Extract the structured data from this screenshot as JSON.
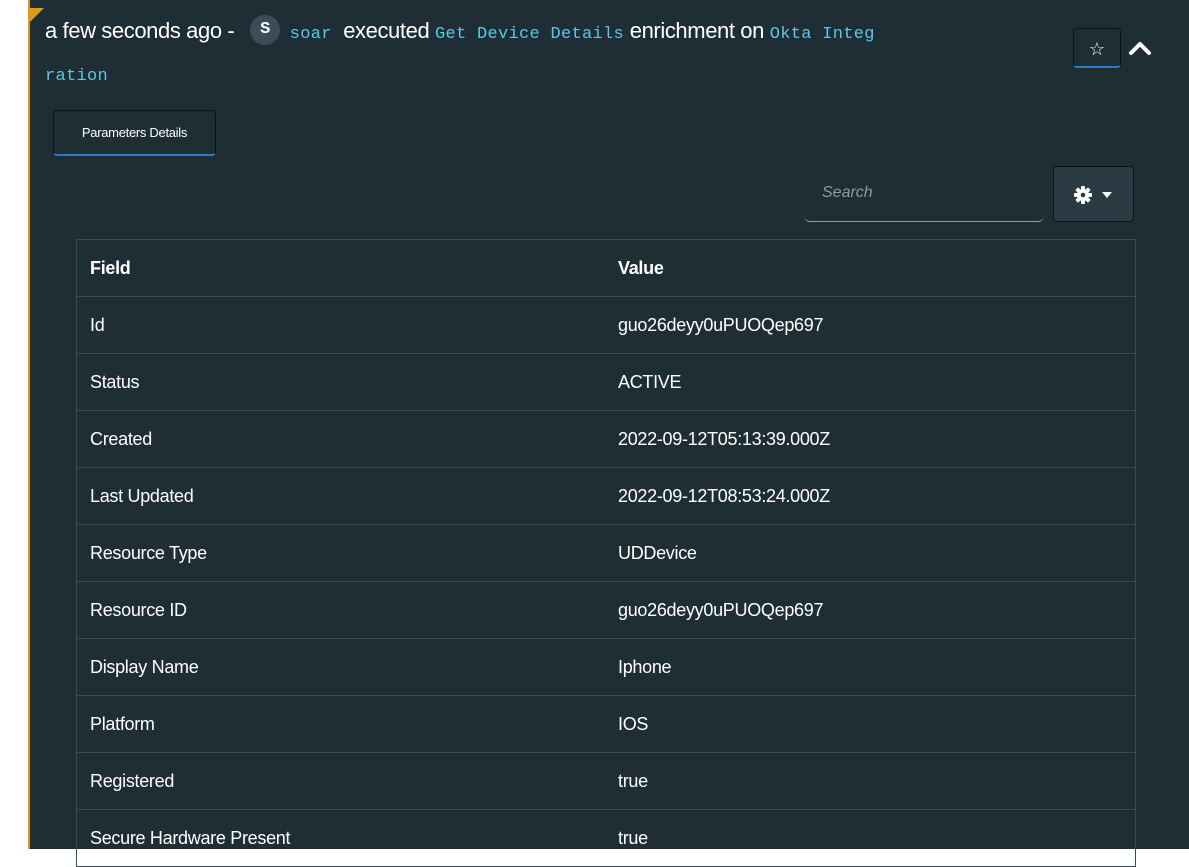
{
  "header": {
    "time": "a few seconds ago -",
    "avatar_letter": "S",
    "user": "soar",
    "executed": "executed",
    "action": "Get Device Details",
    "enrichment_on": "enrichment on",
    "integration_1": "Okta Integ",
    "integration_2": "ration"
  },
  "star_label": "☆",
  "tab_label": "Parameters Details",
  "search": {
    "placeholder": "Search"
  },
  "table": {
    "headers": [
      "Field",
      "Value"
    ],
    "rows": [
      [
        "Id",
        "guo26deyy0uPUOQep697"
      ],
      [
        "Status",
        "ACTIVE"
      ],
      [
        "Created",
        "2022-09-12T05:13:39.000Z"
      ],
      [
        "Last Updated",
        "2022-09-12T08:53:24.000Z"
      ],
      [
        "Resource Type",
        "UDDevice"
      ],
      [
        "Resource ID",
        "guo26deyy0uPUOQep697"
      ],
      [
        "Display Name",
        "Iphone"
      ],
      [
        "Platform",
        "IOS"
      ],
      [
        "Registered",
        "true"
      ],
      [
        "Secure Hardware Present",
        "true"
      ]
    ]
  },
  "icons": {
    "star": "star-icon",
    "collapse": "chevron-up-icon",
    "settings": "gear-icon",
    "dropdown": "caret-down-icon"
  },
  "colors": {
    "background": "#1f2d35",
    "accent_border": "#d99a1c",
    "link": "#5bc8e6",
    "focus_underline": "#2f78c6"
  }
}
